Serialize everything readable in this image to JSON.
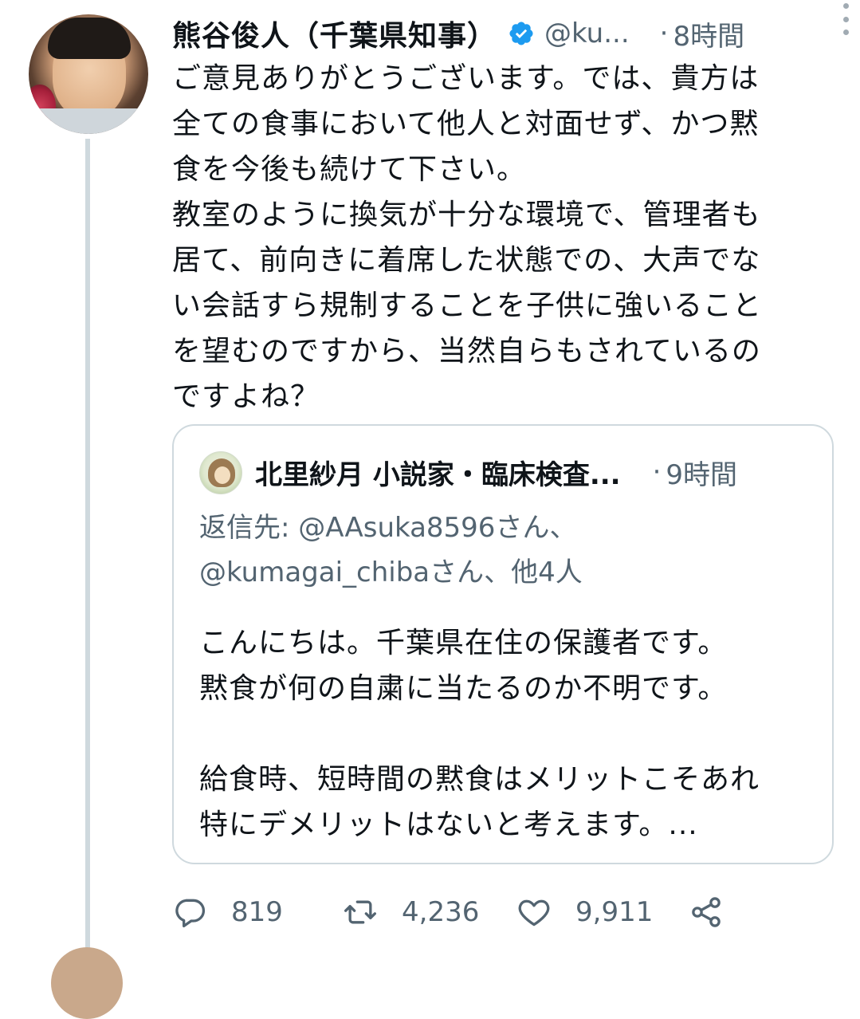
{
  "tweet": {
    "author_name": "熊谷俊人（千葉県知事）",
    "handle": "@ku...",
    "time_separator": "·",
    "time": "8時間",
    "text_lines": [
      "ご意見ありがとうございます。では、貴方は",
      "全ての食事において他人と対面せず、かつ黙",
      "食を今後も続けて下さい。",
      "教室のように換気が十分な環境で、管理者も",
      "居て、前向きに着席した状態での、大声でな",
      "い会話すら規制することを子供に強いること",
      "を望むのですから、当然自らもされているの",
      "ですよね？"
    ]
  },
  "quoted": {
    "author_name": "北里紗月 小説家・臨床検査...",
    "time_separator": "·",
    "time": "9時間",
    "reply_line1": "返信先: @AAsuka8596さん、",
    "reply_line2": "@kumagai_chibaさん、他4人",
    "body_lines": [
      "こんにちは。千葉県在住の保護者です。",
      "黙食が何の自粛に当たるのか不明です。",
      "",
      "給食時、短時間の黙食はメリットこそあれ",
      "特にデメリットはないと考えます。..."
    ]
  },
  "actions": {
    "reply_count": "819",
    "retweet_count": "4,236",
    "like_count": "9,911"
  },
  "colors": {
    "text": "#0f1419",
    "secondary": "#536471",
    "verified": "#1d9bf0",
    "border": "#cfd9de"
  },
  "icons": [
    "verified-badge-icon",
    "more-icon",
    "reply-icon",
    "retweet-icon",
    "like-icon",
    "share-icon"
  ]
}
